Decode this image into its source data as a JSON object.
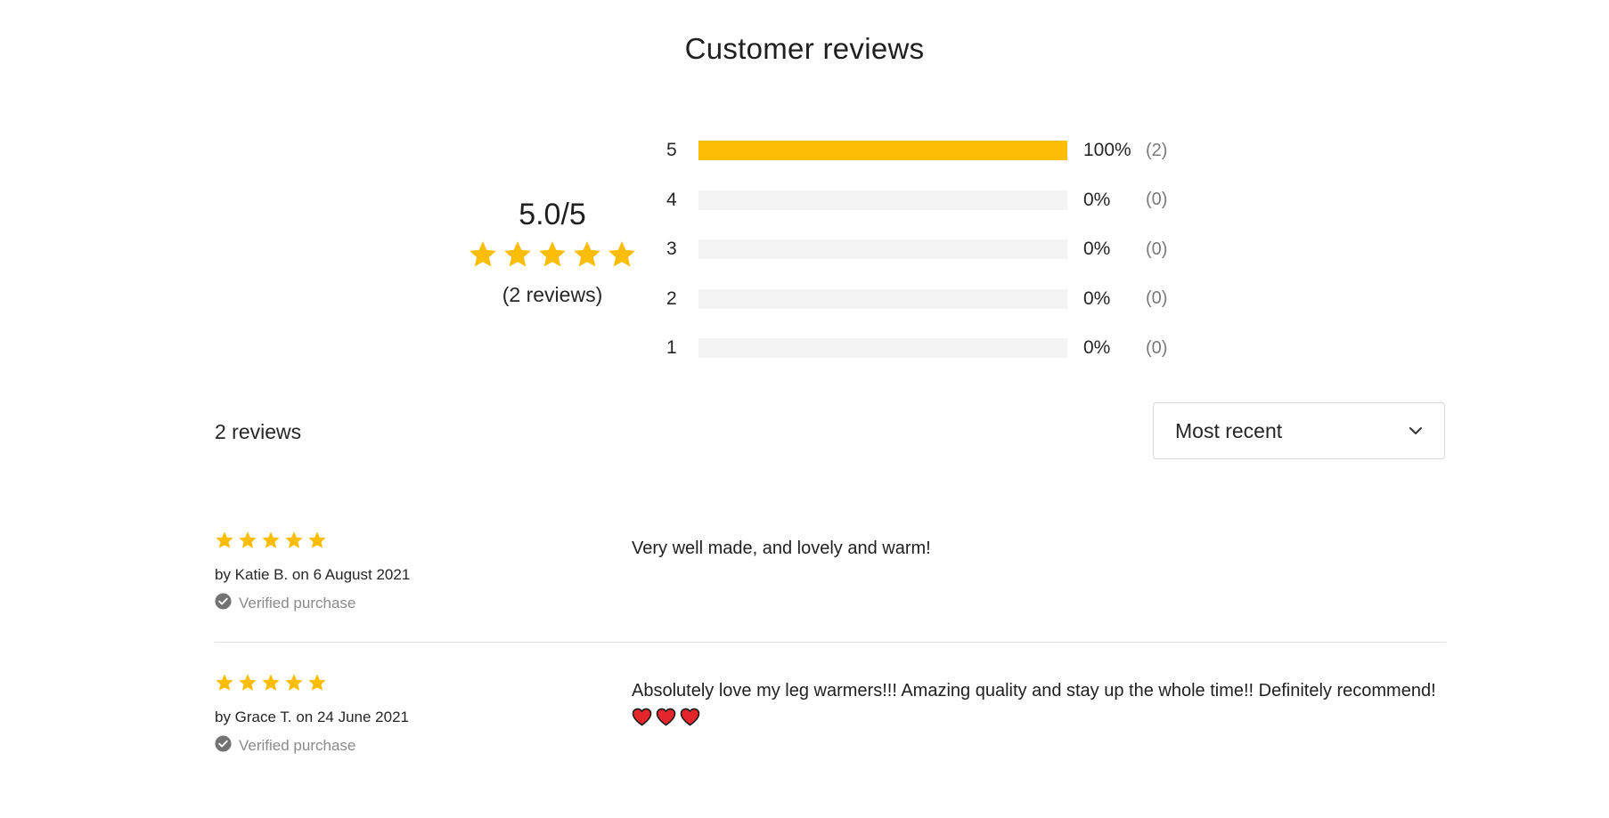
{
  "title": "Customer reviews",
  "colors": {
    "star": "#fbbd06",
    "heart": "#e3262c"
  },
  "summary": {
    "score": "5.0/5",
    "stars": 5,
    "count": "(2 reviews)"
  },
  "distribution": [
    {
      "label": "5",
      "percent": "100%",
      "count": "(2)",
      "fill": 1.0
    },
    {
      "label": "4",
      "percent": "0%",
      "count": "(0)",
      "fill": 0
    },
    {
      "label": "3",
      "percent": "0%",
      "count": "(0)",
      "fill": 0
    },
    {
      "label": "2",
      "percent": "0%",
      "count": "(0)",
      "fill": 0
    },
    {
      "label": "1",
      "percent": "0%",
      "count": "(0)",
      "fill": 0
    }
  ],
  "toolbar": {
    "total": "2 reviews",
    "sort_value": "Most recent",
    "sort_icon": "chevron-down-icon"
  },
  "reviews": [
    {
      "stars": 5,
      "author": "by Katie B. on 6 August 2021",
      "verified": "Verified purchase",
      "text": "Very well made, and lovely and warm!",
      "hearts": 0
    },
    {
      "stars": 5,
      "author": "by Grace T. on 24 June 2021",
      "verified": "Verified purchase",
      "text": "Absolutely love my leg warmers!!! Amazing quality and stay up the whole time!! Definitely recommend!",
      "hearts": 3
    }
  ]
}
